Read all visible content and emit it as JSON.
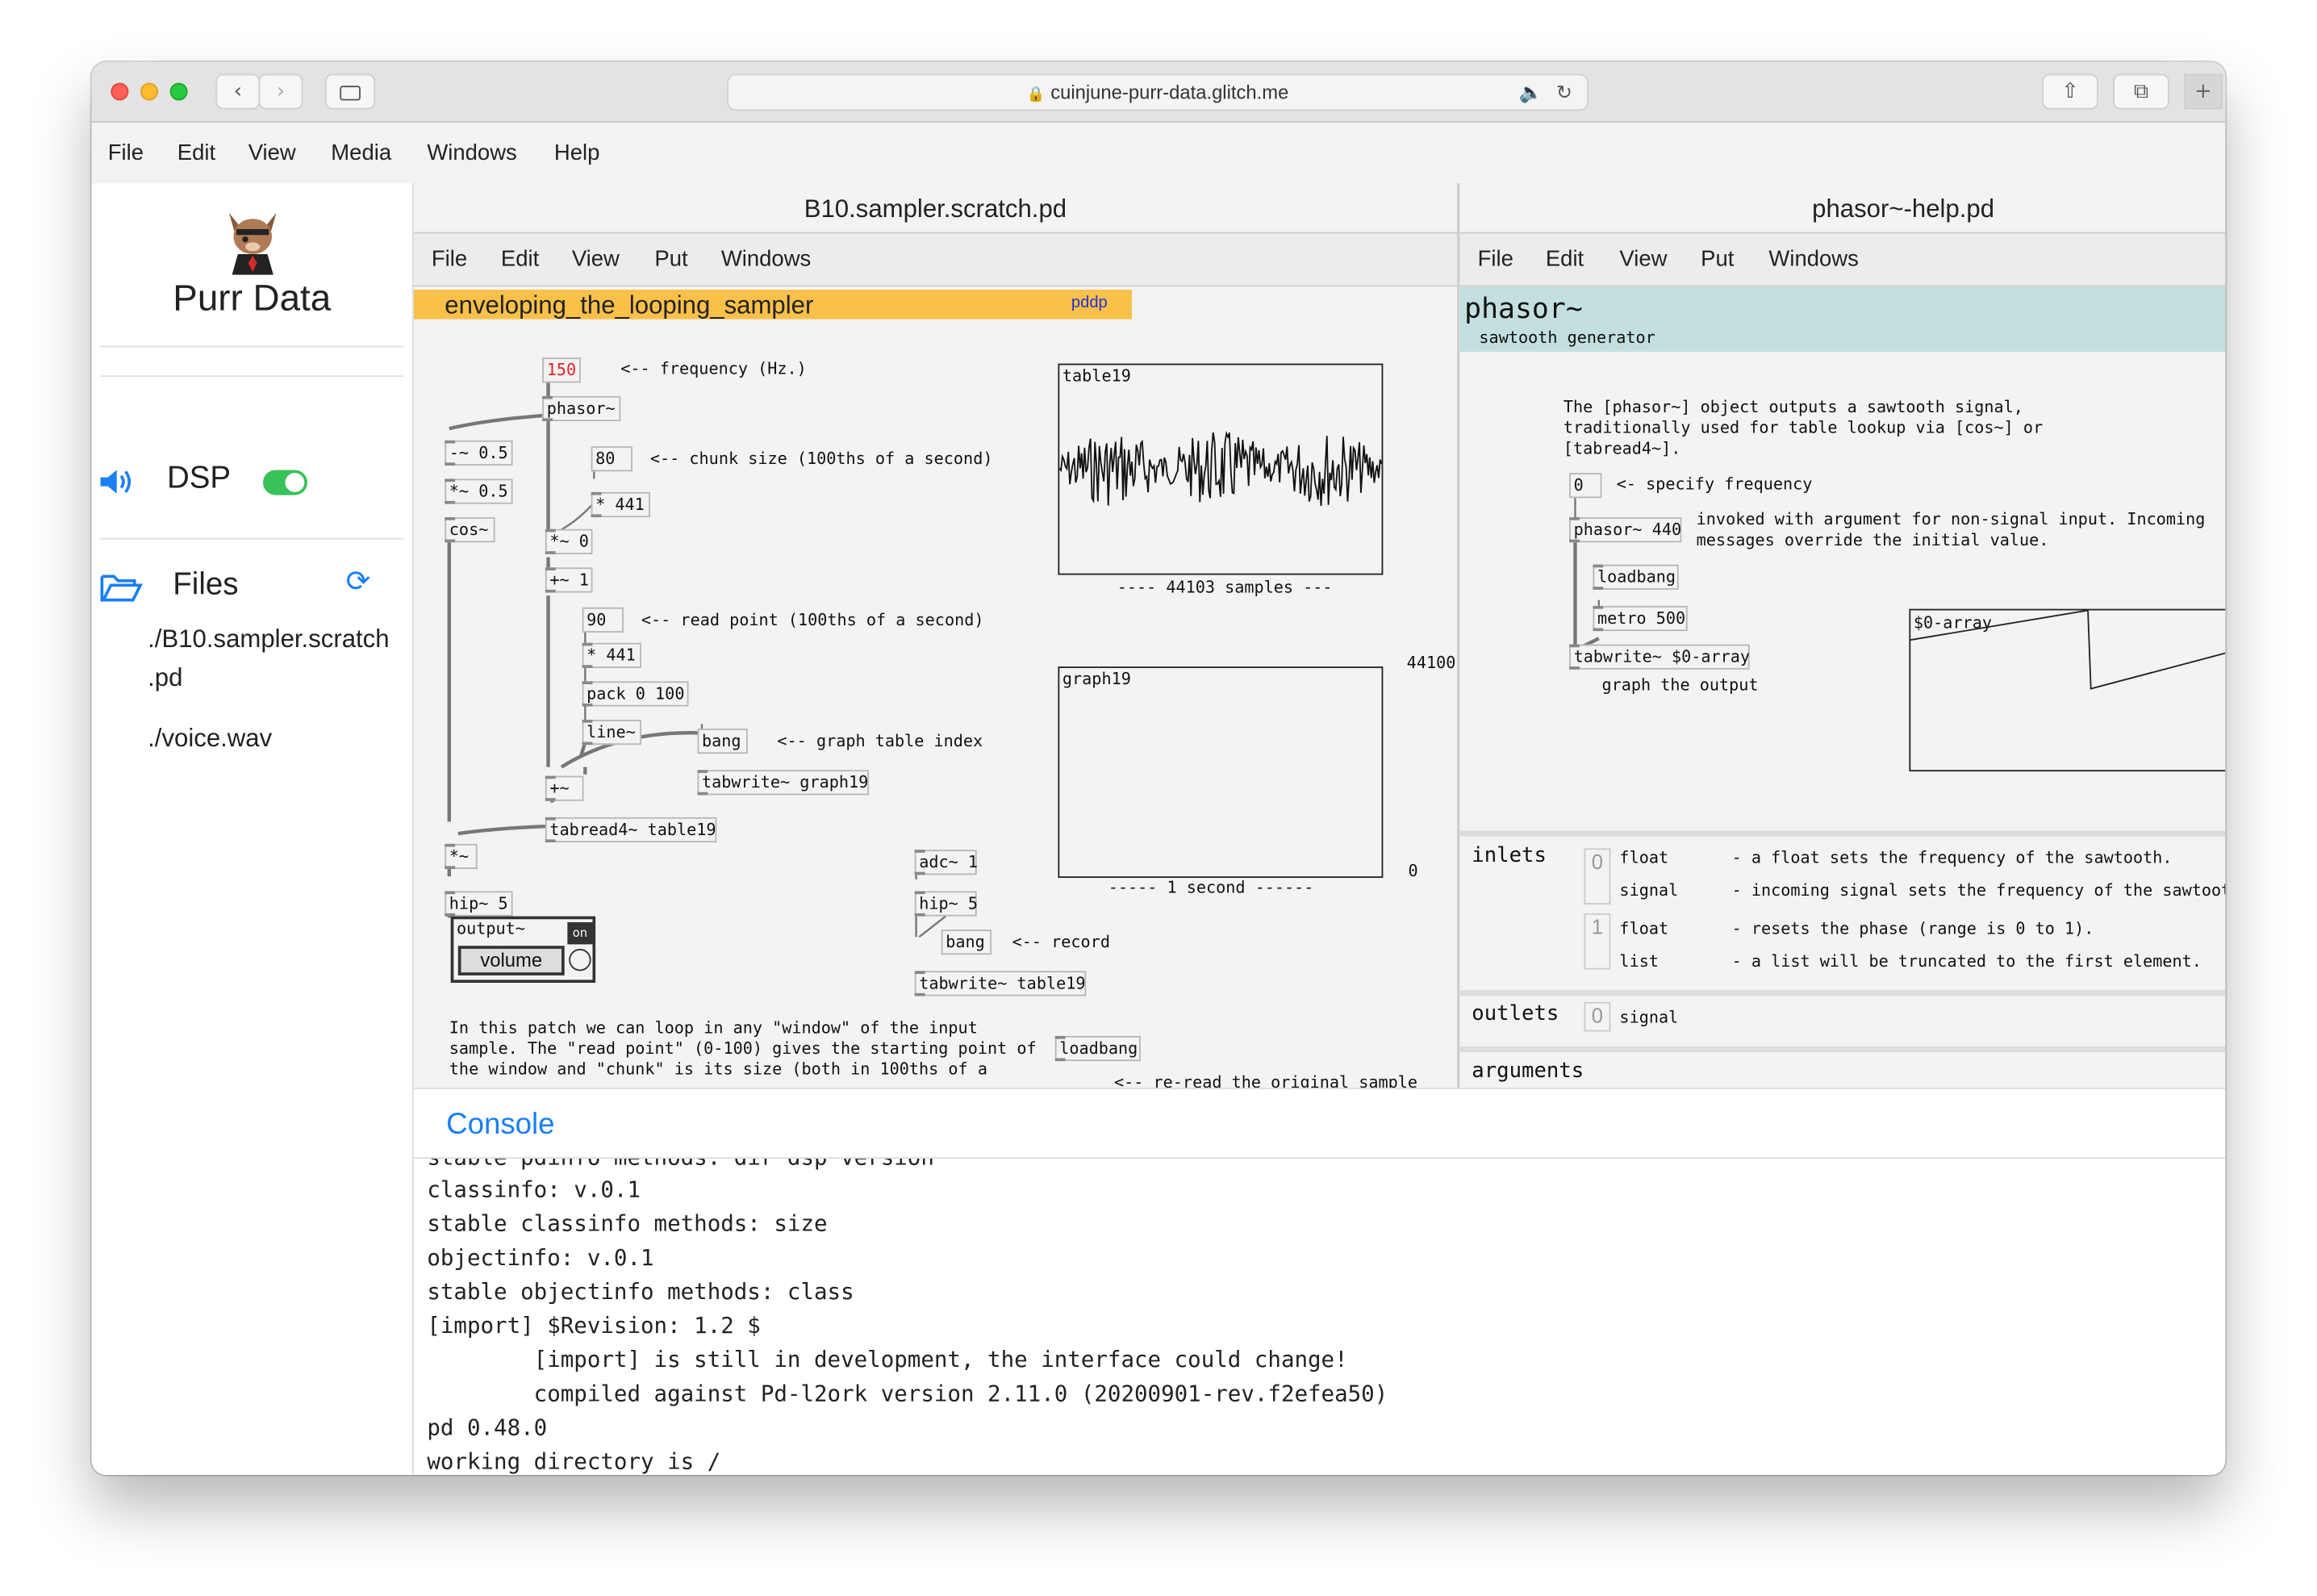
{
  "browser": {
    "url": "cuinjune-purr-data.glitch.me",
    "lock_icon": "lock-icon",
    "sound_icon": "speaker-icon",
    "reload_icon": "reload-icon"
  },
  "app_menu": [
    "File",
    "Edit",
    "View",
    "Media",
    "Windows",
    "Help"
  ],
  "sidebar": {
    "app_name": "Purr Data",
    "dsp_label": "DSP",
    "dsp_on": true,
    "files_label": "Files",
    "files": [
      "./B10.sampler.scratch\n.pd",
      "./voice.wav"
    ]
  },
  "patch_left": {
    "title": "B10.sampler.scratch.pd",
    "menu": [
      "File",
      "Edit",
      "View",
      "Put",
      "Windows"
    ],
    "header": "enveloping_the_looping_sampler",
    "header_tag": "pddp",
    "objects": {
      "freq_num": "150",
      "freq_comment": "<-- frequency (Hz.)",
      "phasor": "phasor~",
      "minus": "-~ 0.5",
      "times": "*~ 0.5",
      "cos": "cos~",
      "chunk_num": "80",
      "chunk_comment": "<-- chunk size (100ths of a second)",
      "mul441a": "* 441",
      "timeszero": "*~ 0",
      "plusone": "+~ 1",
      "read_num": "90",
      "read_comment": "<-- read point (100ths of a second)",
      "mul441b": "* 441",
      "pack": "pack 0 100",
      "line": "line~",
      "bang1": "bang",
      "bang1_comment": "<-- graph table index",
      "tabwrite_graph": "tabwrite~ graph19",
      "plus": "+~",
      "tabread": "tabread4~ table19",
      "times2": "*~",
      "hip1": "hip~ 5",
      "output": "output~",
      "volume": "volume",
      "on": "on",
      "adc": "adc~ 1",
      "hip2": "hip~ 5",
      "bang2": "bang",
      "bang2_comment": "<-- record",
      "tabwrite_table": "tabwrite~ table19",
      "loadbang": "loadbang",
      "loadbang_comment": "<-- re-read the original sample"
    },
    "table19_label": "table19",
    "table19_caption": "---- 44103 samples ---",
    "graph19_label": "graph19",
    "graph19_caption": "----- 1 second ------",
    "graph_ymax": "44100",
    "graph_ymin": "0",
    "description": "In this patch we can loop in any \"window\" of the input\nsample. The \"read point\" (0-100) gives the starting point of\nthe window and \"chunk\" is its size (both in 100ths of a"
  },
  "patch_right": {
    "title": "phasor~-help.pd",
    "menu": [
      "File",
      "Edit",
      "View",
      "Put",
      "Windows"
    ],
    "header": "phasor~",
    "subheader": "sawtooth generator",
    "description": "The [phasor~] object outputs a sawtooth signal,\ntraditionally used for table lookup via [cos~] or\n[tabread4~].",
    "zero_num": "0",
    "specify_comment": "<- specify frequency",
    "phasor440": "phasor~ 440",
    "invoked_comment": "invoked with argument for non-signal input. Incoming\nmessages override the initial value.",
    "loadbang": "loadbang",
    "metro": "metro 500",
    "tabwrite": "tabwrite~ $0-array",
    "graph_comment": "graph the output",
    "array_label": "$0-array",
    "inlets_label": "inlets",
    "inlets": [
      {
        "index": "0",
        "rows": [
          [
            "float",
            "- a float sets the frequency of the sawtooth."
          ],
          [
            "signal",
            "- incoming signal sets the frequency of the sawtooth."
          ]
        ]
      },
      {
        "index": "1",
        "rows": [
          [
            "float",
            "- resets the phase (range is 0 to 1)."
          ],
          [
            "list",
            "- a list will be truncated to the first element."
          ]
        ]
      }
    ],
    "outlets_label": "outlets",
    "outlets": [
      {
        "index": "0",
        "type": "signal"
      }
    ],
    "arguments_label": "arguments"
  },
  "console": {
    "title": "Console",
    "lines": [
      "stable pdinfo methods: dir dsp version",
      "classinfo: v.0.1",
      "stable classinfo methods: size",
      "objectinfo: v.0.1",
      "stable objectinfo methods: class",
      "[import] $Revision: 1.2 $",
      "        [import] is still in development, the interface could change!",
      "        compiled against Pd-l2ork version 2.11.0 (20200901-rev.f2efea50)",
      "pd 0.48.0",
      "working directory is /"
    ]
  },
  "colors": {
    "accent_blue": "#1a7ef5",
    "header_orange": "#f9c04a",
    "header_teal": "#c3dfe0",
    "toggle_green": "#39c25a",
    "freq_red": "#e52222"
  }
}
